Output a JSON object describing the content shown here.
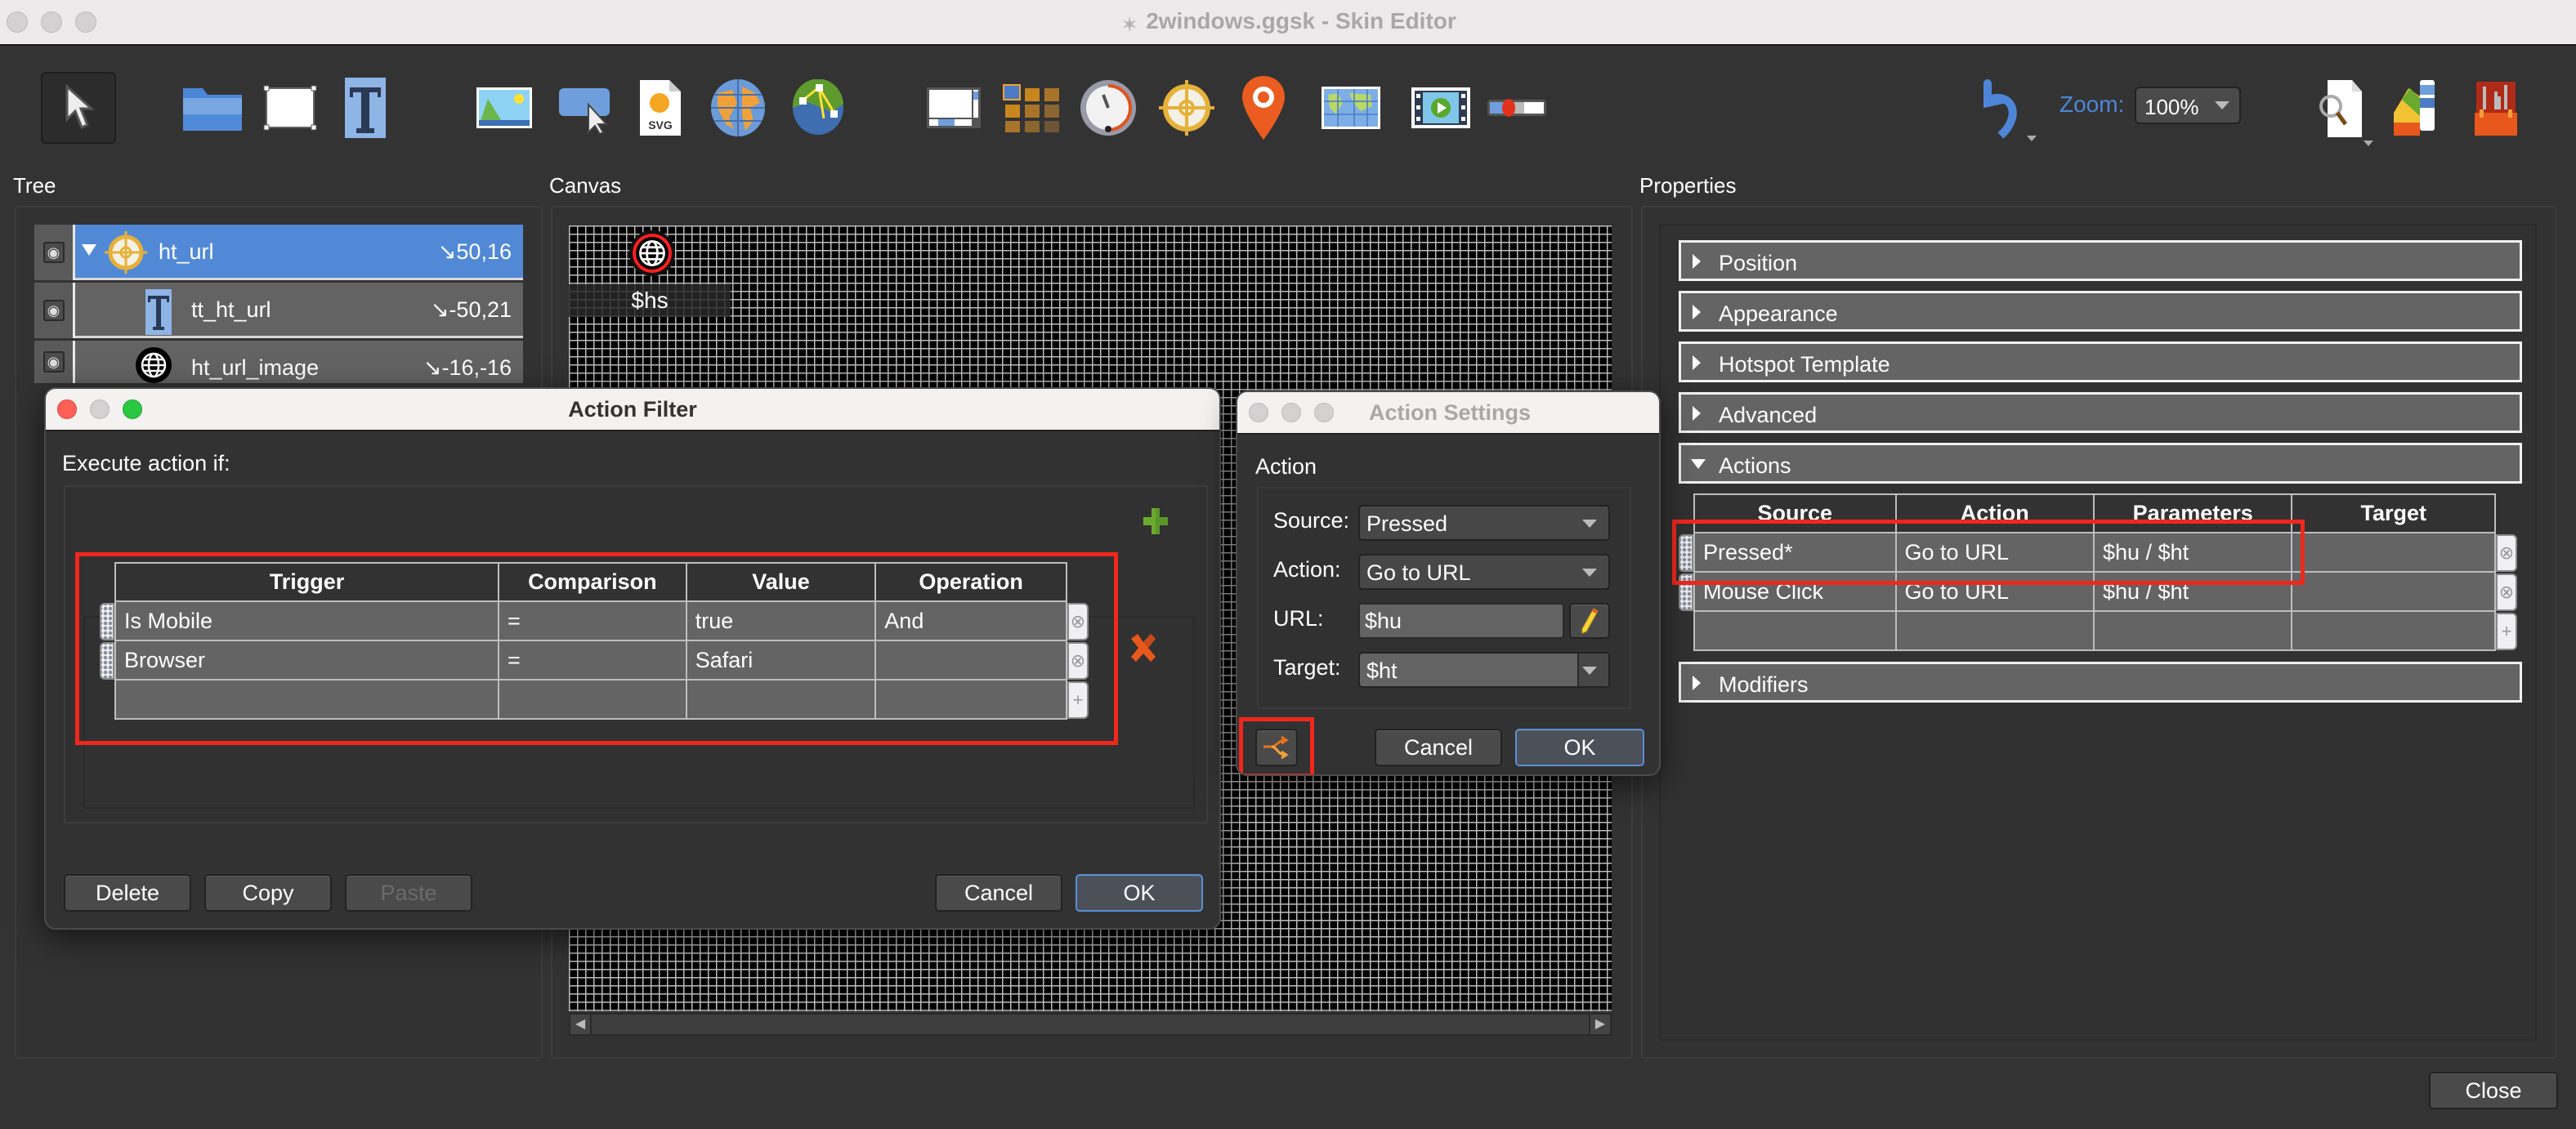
{
  "window": {
    "title": "2windows.ggsk - Skin Editor"
  },
  "toolbar": {
    "tools": [
      {
        "icon": "select-arrow-icon"
      },
      {
        "icon": "folder-container-icon"
      },
      {
        "icon": "rectangle-icon"
      },
      {
        "icon": "text-icon"
      },
      {
        "icon": "image-icon"
      },
      {
        "icon": "button-icon"
      },
      {
        "icon": "svg-icon"
      },
      {
        "icon": "panorama-globe-icon"
      },
      {
        "icon": "nodes-map-icon"
      },
      {
        "icon": "scroll-area-icon"
      },
      {
        "icon": "cloner-grid-icon"
      },
      {
        "icon": "timer-gauge-icon"
      },
      {
        "icon": "hotspot-crosshair-icon"
      },
      {
        "icon": "map-pin-icon"
      },
      {
        "icon": "map-icon"
      },
      {
        "icon": "video-icon"
      },
      {
        "icon": "slider-icon"
      }
    ],
    "undo_icon": "undo-icon",
    "zoom_label": "Zoom:",
    "zoom_value": "100%",
    "right_tools": [
      {
        "icon": "preview-search-icon"
      },
      {
        "icon": "color-palette-icon"
      },
      {
        "icon": "toolbox-icon"
      }
    ]
  },
  "tree": {
    "label": "Tree",
    "items": [
      {
        "name": "ht_url",
        "coord": "↘50,16",
        "icon": "hotspot-crosshair-icon",
        "selected": true,
        "expanded": true
      },
      {
        "name": "tt_ht_url",
        "coord": "↘-50,21",
        "icon": "text-icon",
        "selected": false
      },
      {
        "name": "ht_url_image",
        "coord": "↘-16,-16",
        "icon": "globe-icon",
        "selected": false
      }
    ]
  },
  "canvas": {
    "label": "Canvas",
    "hotspot_text": "$hs"
  },
  "properties": {
    "label": "Properties",
    "sections": [
      {
        "label": "Position",
        "expanded": false
      },
      {
        "label": "Appearance",
        "expanded": false
      },
      {
        "label": "Hotspot Template",
        "expanded": false
      },
      {
        "label": "Advanced",
        "expanded": false
      },
      {
        "label": "Actions",
        "expanded": true
      },
      {
        "label": "Modifiers",
        "expanded": false
      }
    ],
    "actions_table": {
      "columns": [
        "Source",
        "Action",
        "Parameters",
        "Target"
      ],
      "rows": [
        [
          "Pressed*",
          "Go to URL",
          "$hu / $ht",
          ""
        ],
        [
          "Mouse Click",
          "Go to URL",
          "$hu / $ht",
          ""
        ],
        [
          "",
          "",
          "",
          ""
        ]
      ]
    }
  },
  "close_button": "Close",
  "action_filter": {
    "title": "Action Filter",
    "execute_label": "Execute action if:",
    "columns": [
      "Trigger",
      "Comparison",
      "Value",
      "Operation"
    ],
    "rows": [
      [
        "Is Mobile",
        "=",
        "true",
        "And"
      ],
      [
        "Browser",
        "=",
        "Safari",
        ""
      ],
      [
        "",
        "",
        "",
        ""
      ]
    ],
    "buttons": {
      "delete": "Delete",
      "copy": "Copy",
      "paste": "Paste",
      "cancel": "Cancel",
      "ok": "OK"
    }
  },
  "action_settings": {
    "title": "Action Settings",
    "group_label": "Action",
    "source_label": "Source:",
    "source_value": "Pressed",
    "action_label": "Action:",
    "action_value": "Go to URL",
    "url_label": "URL:",
    "url_value": "$hu",
    "target_label": "Target:",
    "target_value": "$ht",
    "buttons": {
      "cancel": "Cancel",
      "ok": "OK"
    }
  },
  "colors": {
    "accent_blue": "#5189d6",
    "highlight_red": "#f1271d",
    "add_green": "#6aaa2e",
    "delete_orange": "#e8571c"
  }
}
